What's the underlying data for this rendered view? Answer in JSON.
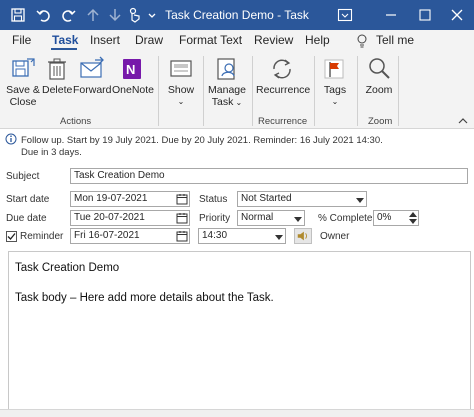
{
  "window": {
    "title": "Task Creation Demo  -  Task",
    "brand_color": "#2b579a"
  },
  "quick_access": {
    "save_icon": "save-icon",
    "undo_icon": "undo-icon",
    "redo_icon": "redo-icon",
    "up_icon": "arrow-up-icon",
    "down_icon": "arrow-down-icon",
    "touch_icon": "touch-mode-icon",
    "customize_icon": "customize-icon"
  },
  "tabs": [
    "File",
    "Task",
    "Insert",
    "Draw",
    "Format Text",
    "Review",
    "Help"
  ],
  "tell_me": "Tell me",
  "ribbon": {
    "save_close": "Save &\nClose",
    "save_line1": "Save &",
    "save_line2": "Close",
    "delete": "Delete",
    "forward": "Forward",
    "onenote": "OneNote",
    "actions_group": "Actions",
    "show": "Show",
    "manage_task_line1": "Manage",
    "manage_task_line2": "Task",
    "recurrence": "Recurrence",
    "recurrence_group": "Recurrence",
    "tags": "Tags",
    "zoom": "Zoom",
    "zoom_group": "Zoom"
  },
  "info": {
    "line1": "Follow up.  Start by 19 July 2021.  Due by 20 July 2021.  Reminder: 16 July 2021 14:30.",
    "line2": "Due in 3 days."
  },
  "form": {
    "subject_label": "Subject",
    "subject_value": "Task Creation Demo",
    "start_label": "Start date",
    "start_value": "Mon 19-07-2021",
    "due_label": "Due date",
    "due_value": "Tue 20-07-2021",
    "reminder_label": "Reminder",
    "reminder_checked": true,
    "reminder_date": "Fri 16-07-2021",
    "reminder_time": "14:30",
    "status_label": "Status",
    "status_value": "Not Started",
    "priority_label": "Priority",
    "priority_value": "Normal",
    "complete_label": "% Complete",
    "complete_value": "0%",
    "owner_label": "Owner"
  },
  "body": {
    "line1": "Task Creation Demo",
    "line2": "Task body – Here add more details about the Task."
  }
}
